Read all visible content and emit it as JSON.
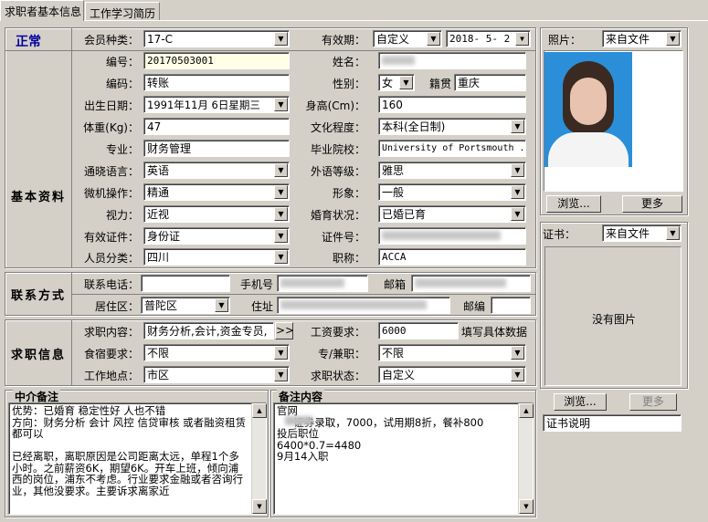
{
  "tabs": [
    "求职者基本信息",
    "工作学习简历"
  ],
  "status": "正常",
  "sections": {
    "basic": "基本资料",
    "contact": "联系方式",
    "jobinfo": "求职信息",
    "agent_notes": "中介备注",
    "remarks": "备注内容"
  },
  "labels": {
    "member_type": "会员种类：",
    "validity": "有效期：",
    "number": "编号：",
    "name": "姓名：",
    "code": "编码：",
    "gender": "性别：",
    "native": "籍贯",
    "birth": "出生日期：",
    "height": "身高(Cm)：",
    "weight": "体重(Kg)：",
    "education": "文化程度：",
    "major": "专业：",
    "school": "毕业院校：",
    "language": "通晓语言：",
    "foreign_level": "外语等级：",
    "computer": "微机操作：",
    "image": "形象：",
    "vision": "视力：",
    "marital": "婚育状况：",
    "id_type": "有效证件：",
    "id_number": "证件号：",
    "category": "人员分类：",
    "title": "职称：",
    "phone": "联系电话：",
    "mobile": "手机号",
    "email": "邮箱",
    "district": "居住区：",
    "address": "住址",
    "postcode": "邮编",
    "job_wanted": "求职内容：",
    "salary": "工资要求：",
    "lodging": "食宿要求：",
    "parttime": "专/兼职：",
    "location": "工作地点：",
    "job_status": "求职状态：",
    "photo": "照片：",
    "certificate": "证书："
  },
  "values": {
    "member_type": "17-C",
    "validity_mode": "自定义",
    "validity_date": "2018- 5- 2",
    "number": "20170503001",
    "code": "转账",
    "gender": "女",
    "native": "重庆",
    "birth": "1991年11月 6日星期三",
    "height": "160",
    "weight": "47",
    "education": "本科(全日制)",
    "major": "财务管理",
    "school": "University of Portsmouth  .",
    "language": "英语",
    "foreign_level": "雅思",
    "computer": "精通",
    "image": "一般",
    "vision": "近视",
    "marital": "已婚已育",
    "id_type": "身份证",
    "category": "四川",
    "title": "ACCA",
    "district": "普陀区",
    "job_wanted": "财务分析,会计,资金专员,",
    "salary": "6000",
    "salary_hint": "填写具体数据",
    "lodging": "不限",
    "parttime": "不限",
    "location": "市区",
    "job_status": "自定义",
    "photo_source": "来自文件",
    "cert_source": "来自文件",
    "no_image": "没有图片",
    "cert_desc": "证书说明"
  },
  "buttons": {
    "browse": "浏览...",
    "more": "更多",
    "expand": ">>"
  },
  "agent_notes": "优势：已婚育 稳定性好 人也不错\n方向：财务分析 会计 风控 信贷审核 或者融资租赁都可以\n\n已经离职，离职原因是公司距离太远，单程1个多小时。之前薪资6K，期望6K。开车上班，倾向浦西的岗位，浦东不考虑。行业要求金融或者咨询行业，其他没要求。主要诉求离家近",
  "remarks": "官网\n     证券录取，7000，试用期8折，餐补800\n投后职位\n6400*0.7=4480\n9月14入职",
  "colors": {
    "status": "#0000a0",
    "background": "#d4d0c8",
    "photo_bg": "#2a8fd8"
  },
  "icons": {
    "dropdown": "chevron-down-icon",
    "scroll_up": "scroll-up-icon",
    "scroll_down": "scroll-down-icon"
  }
}
